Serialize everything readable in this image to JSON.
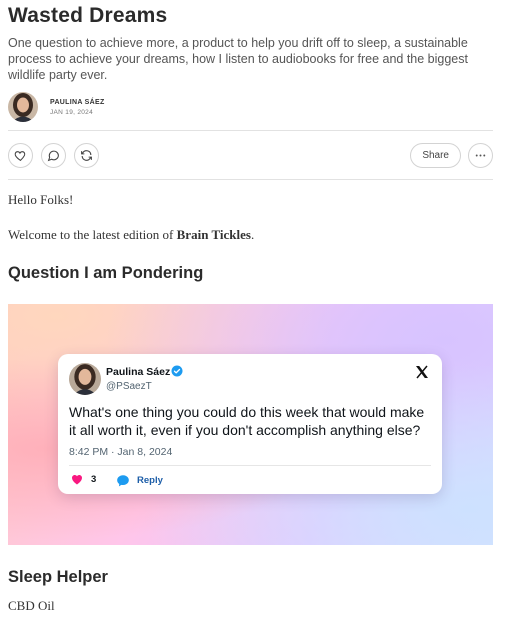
{
  "post": {
    "title": "Wasted Dreams",
    "subtitle": "One question to achieve more, a product to help you drift off to sleep, a sustainable process to achieve your dreams, how I listen to audiobooks for free and the biggest wildlife party ever.",
    "author": "PAULINA SÁEZ",
    "date": "JAN 19, 2024"
  },
  "actions": {
    "share_label": "Share",
    "icons": [
      "heart-icon",
      "comment-icon",
      "restack-icon",
      "more-icon"
    ]
  },
  "body": {
    "greeting": "Hello Folks!",
    "welcome_prefix": "Welcome to the latest edition of ",
    "newsletter_name": "Brain Tickles",
    "welcome_suffix": ".",
    "section1_heading": "Question I am Pondering",
    "section2_heading": "Sleep Helper",
    "section2_text": "CBD Oil"
  },
  "tweet": {
    "name": "Paulina Sáez",
    "handle": "@PSaezT",
    "text": "What's one thing you could do this week that would make it all worth it, even if you don't accomplish anything else?",
    "time": "8:42 PM · Jan 8, 2024",
    "likes": "3",
    "reply_label": "Reply",
    "colors": {
      "like": "#f91880",
      "reply": "#1d9bf0",
      "verified": "#1d9bf0"
    }
  }
}
